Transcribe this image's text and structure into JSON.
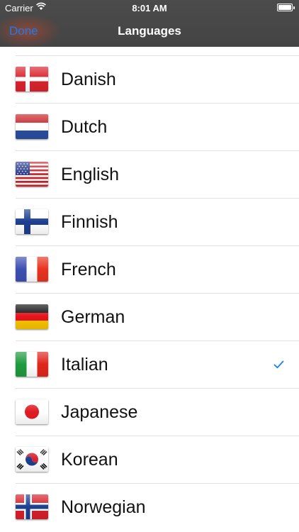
{
  "status_bar": {
    "carrier": "Carrier",
    "time": "8:01 AM"
  },
  "nav": {
    "done_label": "Done",
    "title": "Languages"
  },
  "languages": [
    {
      "label": "Danish",
      "flag_icon": "flag-denmark-icon",
      "selected": false
    },
    {
      "label": "Dutch",
      "flag_icon": "flag-netherlands-icon",
      "selected": false
    },
    {
      "label": "English",
      "flag_icon": "flag-usa-icon",
      "selected": false
    },
    {
      "label": "Finnish",
      "flag_icon": "flag-finland-icon",
      "selected": false
    },
    {
      "label": "French",
      "flag_icon": "flag-france-icon",
      "selected": false
    },
    {
      "label": "German",
      "flag_icon": "flag-germany-icon",
      "selected": false
    },
    {
      "label": "Italian",
      "flag_icon": "flag-italy-icon",
      "selected": true
    },
    {
      "label": "Japanese",
      "flag_icon": "flag-japan-icon",
      "selected": false
    },
    {
      "label": "Korean",
      "flag_icon": "flag-korea-icon",
      "selected": false
    },
    {
      "label": "Norwegian",
      "flag_icon": "flag-norway-icon",
      "selected": false
    }
  ],
  "colors": {
    "accent": "#1a7cf2",
    "nav_bg": "#474747",
    "separator": "#e1e1e1"
  }
}
